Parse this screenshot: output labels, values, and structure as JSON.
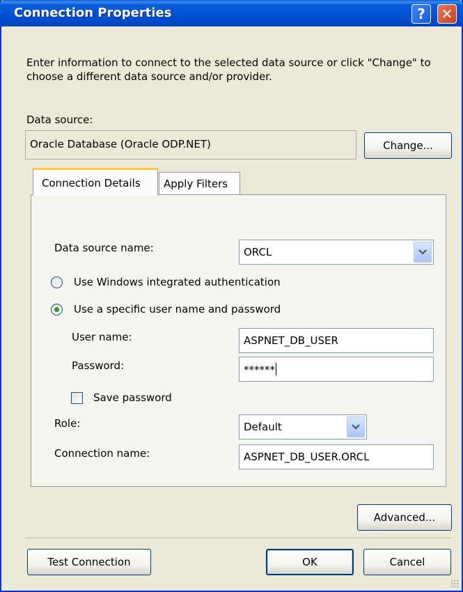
{
  "window": {
    "title": "Connection Properties"
  },
  "titlebar": {
    "help_glyph": "?",
    "close_glyph": "✕"
  },
  "intro": "Enter information to connect to the selected data source or click \"Change\" to choose a different data source and/or provider.",
  "data_source": {
    "label": "Data source:",
    "value": "Oracle Database (Oracle ODP.NET)",
    "change_label": "Change..."
  },
  "tabs": [
    {
      "label": "Connection Details",
      "active": true
    },
    {
      "label": "Apply Filters",
      "active": false
    }
  ],
  "connection_details": {
    "data_source_name_label": "Data source name:",
    "data_source_name_value": "ORCL",
    "auth_options": [
      {
        "label": "Use Windows integrated authentication",
        "checked": false
      },
      {
        "label": "Use a specific user name and password",
        "checked": true
      }
    ],
    "user_name_label": "User name:",
    "user_name_value": "ASPNET_DB_USER",
    "password_label": "Password:",
    "password_value": "******",
    "save_password_label": "Save password",
    "save_password_checked": false,
    "role_label": "Role:",
    "role_value": "Default",
    "connection_name_label": "Connection name:",
    "connection_name_value": "ASPNET_DB_USER.ORCL"
  },
  "buttons": {
    "advanced": "Advanced...",
    "test_connection": "Test Connection",
    "ok": "OK",
    "cancel": "Cancel"
  },
  "colors": {
    "titlebar": "#0053d6",
    "dialog_bg": "#ece9d8",
    "tab_highlight": "#ffc83c",
    "radio_dot": "#21a121"
  },
  "icons": [
    "help-icon",
    "close-icon",
    "chevron-down-icon"
  ]
}
